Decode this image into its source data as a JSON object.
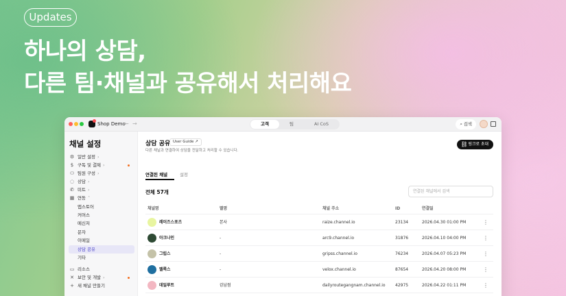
{
  "banner": {
    "pill": "Updates",
    "line1": "하나의 상담,",
    "line2": "다른 팀·채널과 공유해서 처리해요"
  },
  "window": {
    "workspace": "Shop Demo",
    "nav_back": "←",
    "nav_forward": "→",
    "top_tabs": [
      "고객",
      "팀",
      "AI CoS"
    ],
    "search_label": "검색"
  },
  "sidebar": {
    "title": "채널 설정",
    "items": [
      {
        "label": "일반 설정",
        "icon": "gear-icon"
      },
      {
        "label": "구독 및 결제",
        "icon": "dollar-icon"
      },
      {
        "label": "팀원 구성",
        "icon": "people-icon"
      },
      {
        "label": "상담",
        "icon": "chat-icon"
      },
      {
        "label": "미트",
        "icon": "phone-icon"
      },
      {
        "label": "연동",
        "icon": "grid-icon"
      }
    ],
    "sub_items": [
      "앱스토어",
      "커머스",
      "메신저",
      "문자",
      "이메일",
      "상담 공유",
      "기타"
    ],
    "bottom_items": [
      {
        "label": "리소스",
        "icon": "book-icon"
      },
      {
        "label": "보안 및 개발",
        "icon": "tools-icon"
      },
      {
        "label": "새 채널 만들기",
        "icon": "plus-icon"
      }
    ],
    "chevron": "›",
    "chevron_open": "˄",
    "accent": "#f37021",
    "selected_color": "#4b44c9"
  },
  "main": {
    "title": "상담 공유",
    "guide": "User Guide ↗",
    "description": "다른 채널과 연결하여 상담을 전달하고 처리할 수 있습니다.",
    "invite_button": "링크로 초대",
    "tabs": [
      "연결된 채널",
      "설정"
    ],
    "count": "전체 57개",
    "search_placeholder": "연결된 채널에서 검색",
    "columns": [
      "채널명",
      "별명",
      "채널 주소",
      "ID",
      "연결일"
    ],
    "rows": [
      {
        "name": "레이즈스포츠",
        "alias": "본사",
        "url": "raize.channel.io",
        "id": "23134",
        "date": "2026.04.30 01:00 PM",
        "color": "#e8f5a0"
      },
      {
        "name": "아크나인",
        "alias": "-",
        "url": "arc9.channel.io",
        "id": "31876",
        "date": "2026.04.10 04:00 PM",
        "color": "#2e4a34"
      },
      {
        "name": "그립스",
        "alias": "-",
        "url": "gripss.channel.io",
        "id": "76234",
        "date": "2026.04.07 05:23 PM",
        "color": "#c4c2a8"
      },
      {
        "name": "벨록스",
        "alias": "-",
        "url": "velox.channel.io",
        "id": "87654",
        "date": "2026.04.20 08:00 PM",
        "color": "#1f6fa0"
      },
      {
        "name": "데일루트",
        "alias": "강남점",
        "url": "dailyroutegangnam.channel.io",
        "id": "42975",
        "date": "2026.04.22 01:11 PM",
        "color": "#f3b7c2"
      }
    ],
    "more": "⋮"
  }
}
